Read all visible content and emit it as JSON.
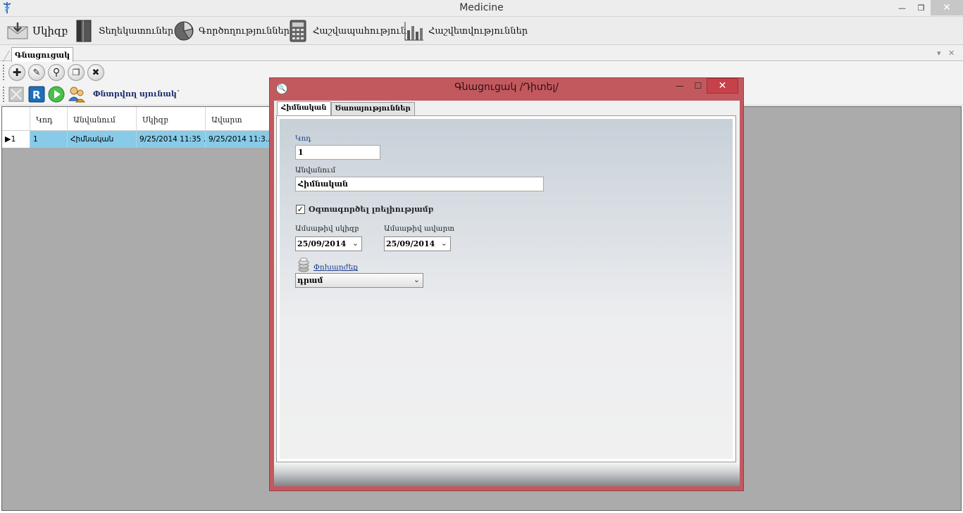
{
  "window": {
    "title": "Medicine",
    "min_glyph": "—",
    "restore_glyph": "❐",
    "close_glyph": "✕"
  },
  "menu": {
    "items": [
      {
        "label": "Սկիզբ",
        "icon": "envelope-down-icon"
      },
      {
        "label": "Տեղեկատուներ",
        "icon": "book-icon"
      },
      {
        "label": "Գործողություններ",
        "icon": "pie-chart-icon"
      },
      {
        "label": "Հաշվապահություն",
        "icon": "calculator-icon"
      },
      {
        "label": "Հաշվետվություններ",
        "icon": "bar-chart-icon"
      }
    ]
  },
  "doc_tab": {
    "label": "Գնացուցակ"
  },
  "toolbar": {
    "add": "✚",
    "edit": "✎",
    "search": "⚲",
    "copy": "❐",
    "delete": "✖",
    "filter_label": "Փնտրվող սյունակ`"
  },
  "grid": {
    "columns": [
      "Կոդ",
      "Անվանում",
      "Սկիզբ",
      "Ավարտ"
    ],
    "rows": [
      {
        "selector": "▶1",
        "code": "1",
        "name": "Հիմնական",
        "start": "9/25/2014 11:35 ...",
        "end": "9/25/2014 11:3..."
      }
    ]
  },
  "dialog": {
    "title": "Գնացուցակ  /Դիտել/",
    "tabs": [
      "Հիմնական",
      "Ծառայություններ"
    ],
    "fields": {
      "code_label": "Կոդ",
      "code_value": "1",
      "name_label": "Անվանում",
      "name_value": "Հիմնական",
      "default_label": "Օգտագործել լռելիությամբ",
      "default_checked": true,
      "start_label": "Ամսաթիվ սկիզբ",
      "start_value": "25/09/2014",
      "end_label": "Ամսաթիվ ավարտ",
      "end_value": "25/09/2014",
      "currency_label": "Փոխարժեք",
      "currency_value": "դրամ"
    }
  },
  "colors": {
    "dialog_border": "#c2595f",
    "selected_row": "#87cbe8",
    "close_button": "#c7414b"
  }
}
